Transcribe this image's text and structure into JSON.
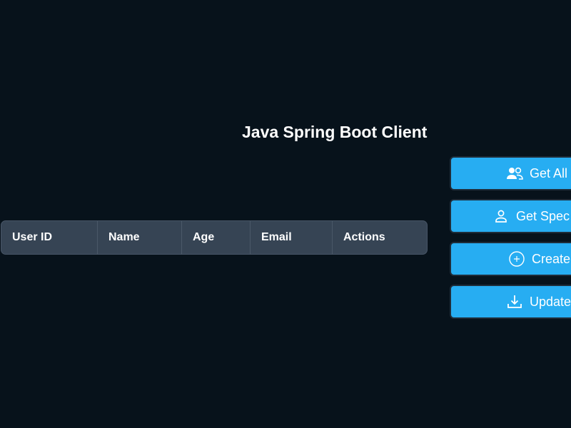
{
  "page": {
    "title": "Java Spring Boot Client"
  },
  "table": {
    "columns": [
      "User ID",
      "Name",
      "Age",
      "Email",
      "Actions"
    ]
  },
  "actions": [
    {
      "label": "Get All",
      "icon": "users-icon"
    },
    {
      "label": "Get Spec",
      "icon": "user-icon"
    },
    {
      "label": "Create",
      "icon": "plus-circle-icon"
    },
    {
      "label": "Update",
      "icon": "download-icon"
    }
  ],
  "colors": {
    "background": "#07121b",
    "table_header": "#364454",
    "button": "#27adf2"
  }
}
